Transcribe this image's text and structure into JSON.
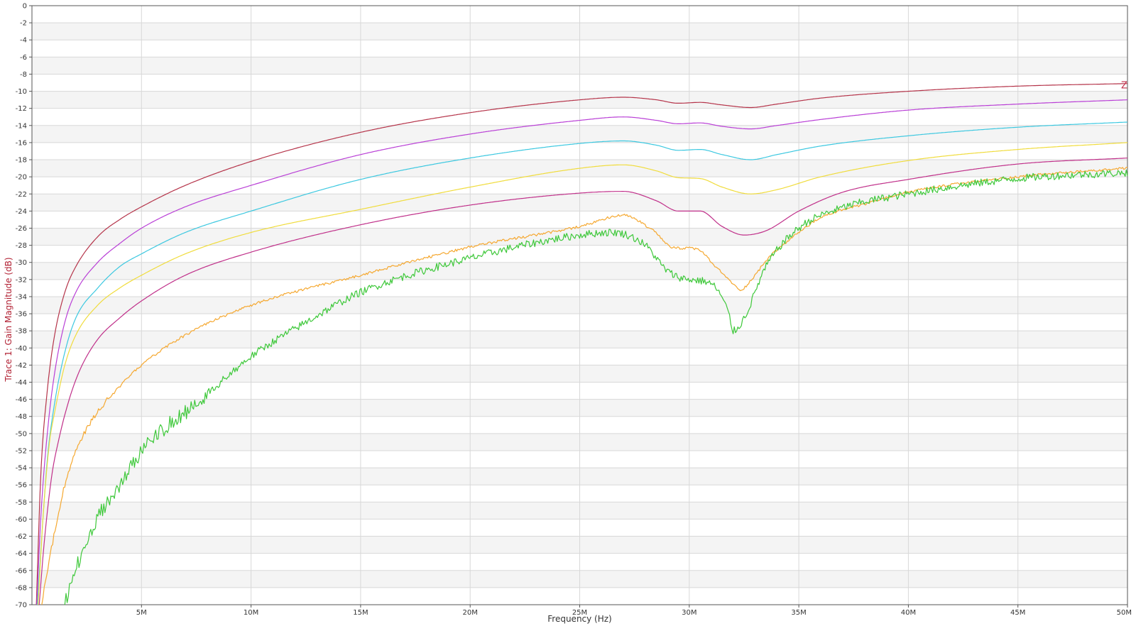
{
  "chart_data": {
    "type": "line",
    "title": "",
    "xlabel": "Frequency (Hz)",
    "ylabel": "Trace 1: Gain Magnitude (dB)",
    "xlim": [
      0,
      50000000
    ],
    "ylim": [
      -70,
      0
    ],
    "grid": true,
    "x_ticks": [
      {
        "value": 5000000,
        "label": "5M"
      },
      {
        "value": 10000000,
        "label": "10M"
      },
      {
        "value": 15000000,
        "label": "15M"
      },
      {
        "value": 20000000,
        "label": "20M"
      },
      {
        "value": 25000000,
        "label": "25M"
      },
      {
        "value": 30000000,
        "label": "30M"
      },
      {
        "value": 35000000,
        "label": "35M"
      },
      {
        "value": 40000000,
        "label": "40M"
      },
      {
        "value": 45000000,
        "label": "45M"
      },
      {
        "value": 50000000,
        "label": "50M"
      }
    ],
    "y_ticks": [
      0,
      -2,
      -4,
      -6,
      -8,
      -10,
      -12,
      -14,
      -16,
      -18,
      -20,
      -22,
      -24,
      -26,
      -28,
      -30,
      -32,
      -34,
      -36,
      -38,
      -40,
      -42,
      -44,
      -46,
      -48,
      -50,
      -52,
      -54,
      -56,
      -58,
      -60,
      -62,
      -64,
      -66,
      -68,
      -70
    ],
    "marker_label": "Z",
    "series": [
      {
        "color": "#b5344a",
        "noise": 0,
        "x": [
          200000,
          400000,
          700000,
          1000000,
          1500000,
          2000000,
          3000000,
          4000000,
          5000000,
          7000000,
          10000000,
          15000000,
          20000000,
          25000000,
          27000000,
          28500000,
          29500000,
          30500000,
          31500000,
          32800000,
          34000000,
          36000000,
          40000000,
          45000000,
          50000000
        ],
        "y": [
          -70,
          -55,
          -45,
          -39,
          -33.5,
          -30.5,
          -27,
          -25,
          -23.5,
          -21,
          -18.2,
          -14.8,
          -12.5,
          -11,
          -10.7,
          -11,
          -11.4,
          -11.3,
          -11.6,
          -11.9,
          -11.5,
          -10.8,
          -10,
          -9.4,
          -9.1
        ]
      },
      {
        "color": "#b93fd6",
        "noise": 0,
        "x": [
          220000,
          400000,
          700000,
          1000000,
          1500000,
          2000000,
          3000000,
          4000000,
          5000000,
          7000000,
          10000000,
          15000000,
          20000000,
          25000000,
          27000000,
          28500000,
          29500000,
          30500000,
          31500000,
          32800000,
          34000000,
          36000000,
          40000000,
          45000000,
          50000000
        ],
        "y": [
          -70,
          -60,
          -50,
          -43.5,
          -37,
          -33.5,
          -30,
          -27.8,
          -26,
          -23.5,
          -21,
          -17.4,
          -15,
          -13.4,
          -13,
          -13.4,
          -13.8,
          -13.7,
          -14.1,
          -14.4,
          -14,
          -13.3,
          -12.2,
          -11.5,
          -11
        ]
      },
      {
        "color": "#3cc8e0",
        "noise": 0,
        "x": [
          250000,
          450000,
          700000,
          1000000,
          1500000,
          2000000,
          3000000,
          4000000,
          5000000,
          7000000,
          10000000,
          15000000,
          20000000,
          25000000,
          27000000,
          28500000,
          29500000,
          30500000,
          31500000,
          32800000,
          34000000,
          36000000,
          40000000,
          45000000,
          50000000
        ],
        "y": [
          -70,
          -62,
          -53,
          -47,
          -40.5,
          -36.5,
          -33,
          -30.5,
          -29,
          -26.5,
          -24,
          -20.3,
          -17.8,
          -16.1,
          -15.8,
          -16.3,
          -16.9,
          -16.8,
          -17.4,
          -18,
          -17.4,
          -16.4,
          -15.2,
          -14.2,
          -13.6
        ]
      },
      {
        "color": "#f0dc3c",
        "noise": 0,
        "x": [
          280000,
          500000,
          800000,
          1000000,
          1500000,
          2000000,
          3000000,
          4000000,
          5000000,
          7000000,
          10000000,
          15000000,
          20000000,
          25000000,
          27000000,
          28500000,
          29500000,
          30500000,
          31500000,
          32800000,
          34000000,
          36000000,
          40000000,
          45000000,
          50000000
        ],
        "y": [
          -70,
          -60,
          -51,
          -48,
          -42,
          -38.5,
          -35,
          -33,
          -31.5,
          -29,
          -26.5,
          -23.8,
          -21.2,
          -19,
          -18.6,
          -19.3,
          -20.1,
          -20.2,
          -21.2,
          -22,
          -21.5,
          -20,
          -18.1,
          -16.8,
          -16
        ]
      },
      {
        "color": "#c0308a",
        "noise": 0,
        "x": [
          330000,
          550000,
          900000,
          1200000,
          1700000,
          2200000,
          3000000,
          4000000,
          5000000,
          7000000,
          10000000,
          15000000,
          20000000,
          25000000,
          27000000,
          28500000,
          29500000,
          30500000,
          31500000,
          32500000,
          33500000,
          35000000,
          37000000,
          40000000,
          45000000,
          50000000
        ],
        "y": [
          -70,
          -63,
          -55,
          -51,
          -46,
          -42.5,
          -39,
          -36.5,
          -34.5,
          -31.5,
          -28.8,
          -25.6,
          -23.3,
          -21.9,
          -21.7,
          -22.8,
          -24,
          -24,
          -25.8,
          -26.8,
          -26.3,
          -24,
          -21.8,
          -20.3,
          -18.5,
          -17.8
        ]
      },
      {
        "color": "#f5a830",
        "noise": 0.15,
        "x": [
          450000,
          700000,
          1000000,
          1500000,
          2000000,
          3000000,
          4000000,
          5000000,
          7000000,
          10000000,
          15000000,
          20000000,
          25000000,
          27000000,
          28300000,
          29300000,
          30300000,
          31200000,
          32000000,
          32300000,
          33000000,
          33500000,
          34500000,
          36000000,
          38000000,
          40000000,
          45000000,
          50000000
        ],
        "y": [
          -70,
          -66,
          -62,
          -56,
          -52,
          -47.5,
          -44.5,
          -42,
          -38.5,
          -35,
          -31.5,
          -28.2,
          -25.8,
          -24.5,
          -26.2,
          -28.3,
          -28.4,
          -30.5,
          -32.5,
          -33.2,
          -31.5,
          -29.8,
          -27.5,
          -24.8,
          -23.2,
          -21.8,
          -20,
          -19
        ]
      },
      {
        "color": "#3ec83a",
        "noise": 0.45,
        "x": [
          1500000,
          1800000,
          2200000,
          2700000,
          3200000,
          4000000,
          5000000,
          6000000,
          7500000,
          10000000,
          12500000,
          15000000,
          20000000,
          25000000,
          26500000,
          28000000,
          29000000,
          30000000,
          31000000,
          31800000,
          32000000,
          32500000,
          33500000,
          35000000,
          37000000,
          40000000,
          45000000,
          50000000
        ],
        "y": [
          -70,
          -67.5,
          -64.5,
          -61.5,
          -59,
          -56,
          -52,
          -49.5,
          -46.5,
          -41,
          -37,
          -33.5,
          -29.5,
          -26.8,
          -26.5,
          -28,
          -31,
          -32,
          -32.5,
          -36,
          -38,
          -36.5,
          -30.5,
          -26,
          -23.6,
          -22,
          -20.2,
          -19.5
        ]
      }
    ]
  }
}
